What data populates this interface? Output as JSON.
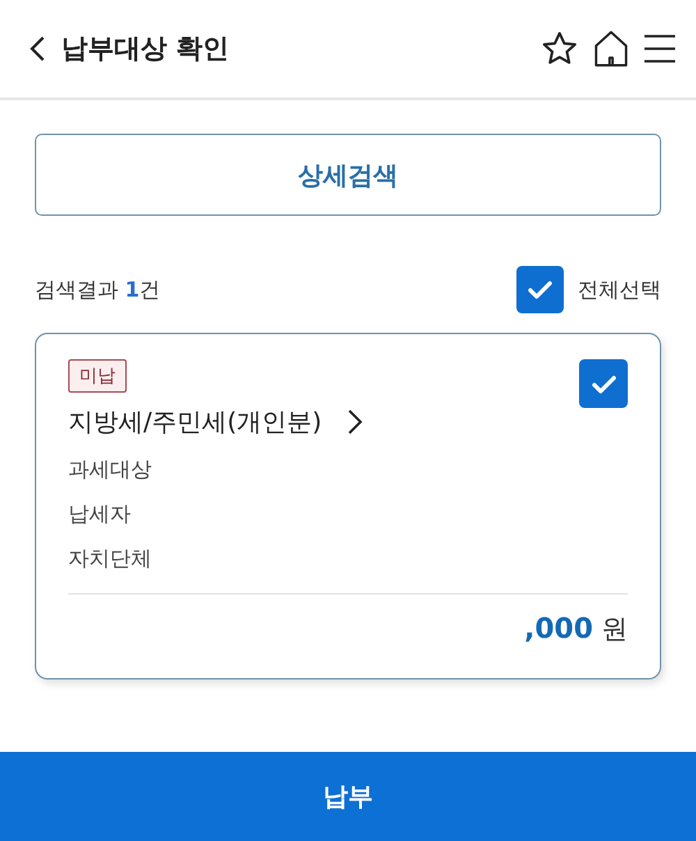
{
  "header": {
    "title": "납부대상 확인"
  },
  "search_button": "상세검색",
  "results": {
    "label": "검색결과",
    "count": "1",
    "unit": "건"
  },
  "select_all": {
    "label": "전체선택",
    "checked": true
  },
  "items": [
    {
      "status": "미납",
      "checked": true,
      "title": "지방세/주민세(개인분)",
      "fields": [
        "과세대상",
        "납세자",
        "자치단체"
      ],
      "amount": ",000",
      "currency": "원"
    }
  ],
  "pay_button": "납부"
}
